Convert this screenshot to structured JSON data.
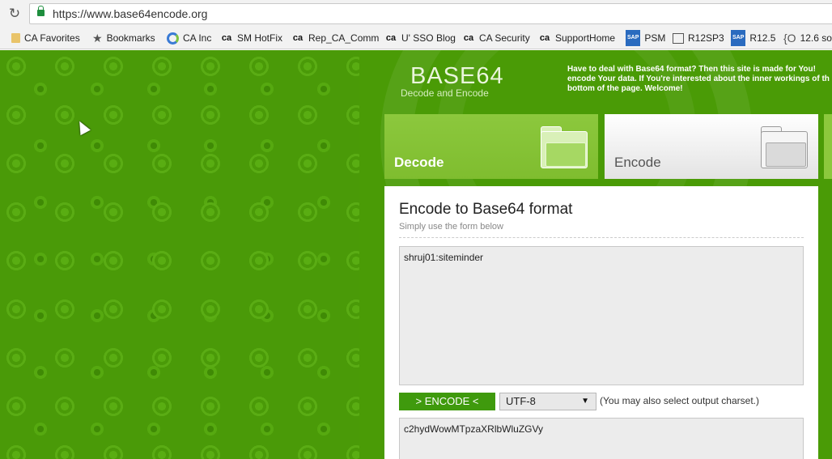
{
  "browser": {
    "url": "https://www.base64encode.org",
    "bookmarks": [
      {
        "label": "CA Favorites",
        "icon": "folder-icon"
      },
      {
        "label": "Bookmarks",
        "icon": "star-icon"
      },
      {
        "label": "CA Inc",
        "icon": "ca-inc-icon"
      },
      {
        "label": "SM HotFix",
        "icon": "ca-logo-icon"
      },
      {
        "label": "Rep_CA_Comm",
        "icon": "ca-logo-icon"
      },
      {
        "label": "U' SSO Blog",
        "icon": "ca-logo-icon"
      },
      {
        "label": "CA Security",
        "icon": "ca-logo-icon"
      },
      {
        "label": "SupportHome",
        "icon": "ca-logo-icon"
      },
      {
        "label": "PSM",
        "icon": "sap-icon"
      },
      {
        "label": "R12SP3",
        "icon": "page-icon"
      },
      {
        "label": "R12.5",
        "icon": "sap-icon"
      },
      {
        "label": "12.6 sou",
        "icon": "brace-icon"
      }
    ]
  },
  "site": {
    "logo_title": "BASE64",
    "logo_subtitle": "Decode and Encode",
    "intro_text": "Have to deal with Base64 format? Then this site is made for You! encode Your data. If You're interested about the inner workings of th bottom of the page. Welcome!",
    "tabs": [
      {
        "label": "Decode",
        "active": false
      },
      {
        "label": "Encode",
        "active": true
      }
    ]
  },
  "encode_panel": {
    "title": "Encode to Base64 format",
    "subtitle": "Simply use the form below",
    "input_value": "shruj01:siteminder",
    "encode_button": "> ENCODE <",
    "charset_selected": "UTF-8",
    "charset_note": "(You may also select output charset.)",
    "output_value": "c2hydWowMTpzaXRlbWluZGVy"
  },
  "colors": {
    "page_green": "#4a9b06",
    "button_green": "#3f9a0d",
    "decode_tab": "#8cc83d"
  }
}
